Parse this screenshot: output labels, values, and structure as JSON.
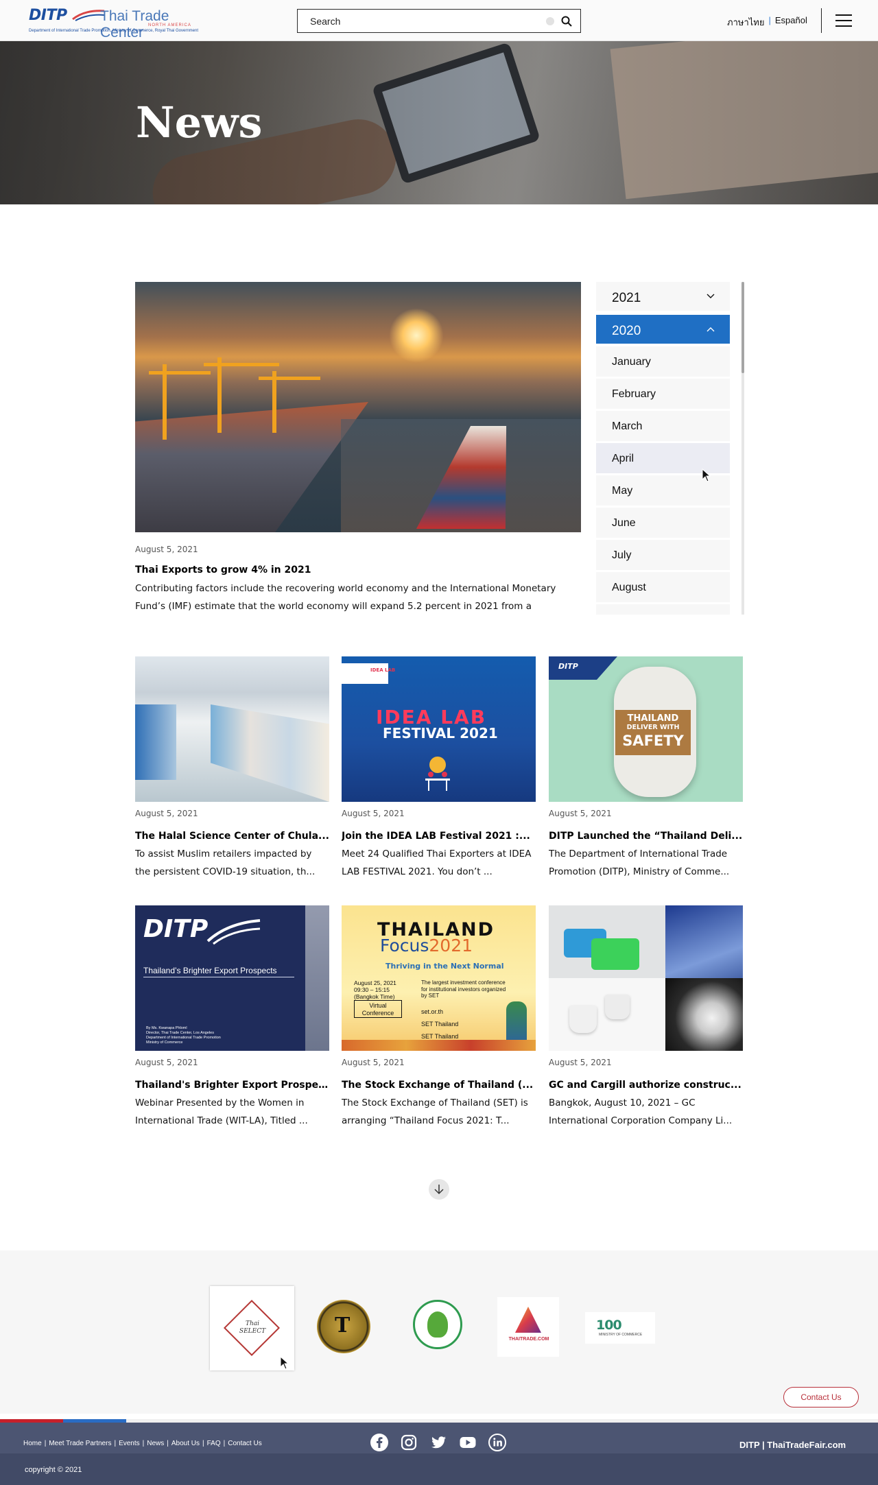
{
  "header": {
    "logo": {
      "mark": "DITP",
      "name": "Thai Trade Center",
      "region": "NORTH AMERICA",
      "tagline": "Department of International Trade Promotion, Ministry of Commerce, Royal Thai Government"
    },
    "search": {
      "placeholder": "Search"
    },
    "languages": [
      "ภาษาไทย",
      "Español"
    ],
    "menu_icon": "hamburger-menu-icon"
  },
  "hero": {
    "title": "News"
  },
  "featured": {
    "date": "August 5, 2021",
    "title": "Thai Exports to grow 4% in 2021",
    "excerpt": "Contributing factors include the recovering world economy and the International Monetary Fund’s (IMF) estimate that the world economy will expand 5.2 percent in 2021 from a"
  },
  "archive": {
    "years": [
      {
        "label": "2021",
        "expanded": false
      },
      {
        "label": "2020",
        "expanded": true
      }
    ],
    "months": [
      "January",
      "February",
      "March",
      "April",
      "May",
      "June",
      "July",
      "August"
    ],
    "hovered_month": "April"
  },
  "articles": [
    {
      "date": "August 5, 2021",
      "title": "The Halal Science Center of Chula...",
      "excerpt": "To assist Muslim retailers impacted by the persistent COVID-19 situation, th..."
    },
    {
      "date": "August 5, 2021",
      "title": "Join the IDEA LAB Festival 2021 :...",
      "excerpt": "Meet 24 Qualified Thai Exporters at IDEA LAB FESTIVAL 2021. You don’t ...",
      "image_text": {
        "tag": "IDEA LAB",
        "logo": "IDEA LAB",
        "subtitle": "FESTIVAL 2021"
      }
    },
    {
      "date": "August 5, 2021",
      "title": "DITP Launched the “Thailand Deli...",
      "excerpt": "The Department of International Trade Promotion (DITP), Ministry of Comme...",
      "image_text": {
        "brand": "DITP",
        "line1": "THAILAND",
        "line2": "DELIVER WITH",
        "line3": "SAFETY"
      }
    },
    {
      "date": "August 5, 2021",
      "title": "Thailand's Brighter Export Prospe...",
      "excerpt": "Webinar Presented by the Women in International Trade (WIT-LA), Titled ...",
      "image_text": {
        "brand": "DITP",
        "banner": "Thailand’s Brighter Export Prospects",
        "credits": "By Ms. Kwanapa Phloml\nDirector, Thai Trade Center, Los Angeles\nDepartment of International Trade Promotion\nMinistry of Commerce"
      }
    },
    {
      "date": "August 5, 2021",
      "title": "The Stock Exchange of Thailand (...",
      "excerpt": "The Stock Exchange of Thailand (SET) is arranging “Thailand Focus 2021: T...",
      "image_text": {
        "brand": "THAILAND",
        "focus": "Focus",
        "year": "2021",
        "tagline": "Thriving in the Next Normal",
        "when": "August 25, 2021\n09:30 – 15:15\n(Bangkok Time)",
        "format": "Virtual Conference",
        "info": "The largest investment conference for institutional investors organized by SET",
        "links": [
          "set.or.th",
          "SET Thailand",
          "SET Thailand"
        ]
      }
    },
    {
      "date": "August 5, 2021",
      "title": "GC and Cargill authorize construc...",
      "excerpt": "Bangkok, August 10, 2021 – GC International Corporation Company Li..."
    }
  ],
  "load_more_icon": "arrow-down-icon",
  "partners": [
    {
      "name": "thai-select-logo",
      "text": "Thai SELECT"
    },
    {
      "name": "thailand-trust-mark-logo",
      "text": "T"
    },
    {
      "name": "agriculture-ministry-logo",
      "text": ""
    },
    {
      "name": "thaitrade-com-logo",
      "text": "THAITRADE.COM"
    },
    {
      "name": "ministry-of-commerce-100-logo",
      "text": "100",
      "sub": "MINISTRY OF COMMERCE"
    }
  ],
  "contact_button": "Contact Us",
  "footer": {
    "nav": [
      "Home",
      "Meet Trade Partners",
      "Events",
      "News",
      "About Us",
      "FAQ",
      "Contact Us"
    ],
    "socials": [
      "facebook-icon",
      "instagram-icon",
      "twitter-icon",
      "youtube-icon",
      "linkedin-icon"
    ],
    "brand": "DITP | ThaiTradeFair.com",
    "copyright": "copyright © 2021"
  },
  "colors": {
    "accent_blue": "#1f6fc4",
    "footer_bg": "#4c5572",
    "contact_red": "#b8303a"
  }
}
